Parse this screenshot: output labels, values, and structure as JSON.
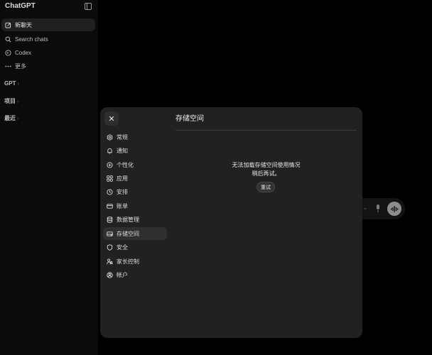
{
  "app": {
    "title": "ChatGPT"
  },
  "sidebar": {
    "items": [
      {
        "label": "新聊天",
        "icon": "edit-icon"
      },
      {
        "label": "Search chats",
        "icon": "search-icon"
      },
      {
        "label": "Codex",
        "icon": "codex-icon"
      },
      {
        "label": "更多",
        "icon": "more-icon"
      }
    ],
    "sections": [
      {
        "label": "GPT",
        "chevron": "›"
      },
      {
        "label": "项目",
        "chevron": "›"
      },
      {
        "label": "最近",
        "chevron": "›"
      }
    ]
  },
  "composer": {
    "chevron": "⌄"
  },
  "settings": {
    "close_symbol": "✕",
    "menu": [
      {
        "label": "常规",
        "icon": "gear-icon"
      },
      {
        "label": "通知",
        "icon": "bell-icon"
      },
      {
        "label": "个性化",
        "icon": "personalize-icon"
      },
      {
        "label": "应用",
        "icon": "apps-icon"
      },
      {
        "label": "安排",
        "icon": "schedule-icon"
      },
      {
        "label": "账单",
        "icon": "billing-icon"
      },
      {
        "label": "数据管理",
        "icon": "database-icon"
      },
      {
        "label": "存储空间",
        "icon": "storage-icon"
      },
      {
        "label": "安全",
        "icon": "shield-icon"
      },
      {
        "label": "家长控制",
        "icon": "parental-icon"
      },
      {
        "label": "帐户",
        "icon": "account-icon"
      }
    ],
    "active_index": 7,
    "title": "存储空间",
    "error_line1": "无法加载存储空间使用情况",
    "error_line2": "稍后再试。",
    "retry_label": "重试"
  }
}
